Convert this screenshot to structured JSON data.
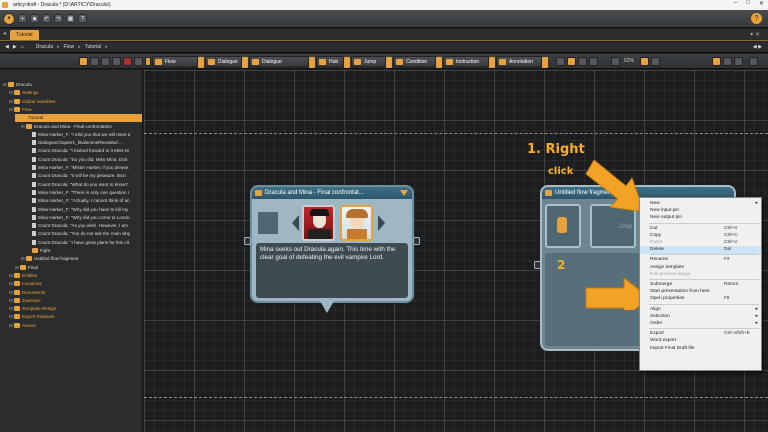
{
  "window": {
    "title": "articy:draft - Dracula * (D:\\ARTICY\\Dracula\\)"
  },
  "tabs": [
    {
      "label": "Tutorial"
    }
  ],
  "breadcrumb": {
    "items": [
      "Dracula",
      "Flow",
      "Tutorial"
    ]
  },
  "object_toolbar": {
    "buttons": [
      "Flow Fragment",
      "Dialogue",
      "Dialogue Fragment",
      "Hub",
      "Jump",
      "Condition",
      "Instruction",
      "Annotation"
    ],
    "zoom_value": "62%"
  },
  "tree": {
    "items": [
      {
        "label": "Dracula",
        "depth": 0,
        "icon": "project-icon"
      },
      {
        "label": "Settings",
        "depth": 1,
        "icon": "folder-icon",
        "orange": true
      },
      {
        "label": "Global Variables",
        "depth": 1,
        "icon": "folder-icon",
        "orange": true
      },
      {
        "label": "Flow",
        "depth": 1,
        "icon": "folder-icon",
        "orange": true
      },
      {
        "label": "Tutorial",
        "depth": 2,
        "icon": "folder-icon",
        "selected": true
      },
      {
        "label": "Dracula and Mina - Final confrontation",
        "depth": 3,
        "icon": "folder-icon"
      },
      {
        "label": "Mina Harker_F: \"I told you that we will meet a",
        "depth": 4,
        "icon": "doc-icon"
      },
      {
        "label": "DialogueChapter1_finalsceneRevealed ...",
        "depth": 4,
        "icon": "doc-icon"
      },
      {
        "label": "Count Dracula: \"I looked forward to it Miss M",
        "depth": 4,
        "icon": "doc-icon"
      },
      {
        "label": "Count Dracula: \"So you did, Miss Mina.  Don",
        "depth": 4,
        "icon": "doc-icon"
      },
      {
        "label": "Mina Harker_F: \"Mister Harker, if you please.",
        "depth": 4,
        "icon": "doc-icon"
      },
      {
        "label": "Count Dracula: \"It will be my pleasure. But I",
        "depth": 4,
        "icon": "doc-icon"
      },
      {
        "label": "Count Dracula: \"What do you want to know?",
        "depth": 4,
        "icon": "doc-icon"
      },
      {
        "label": "Mina Harker_F: \"There is only one question I",
        "depth": 4,
        "icon": "doc-icon"
      },
      {
        "label": "Mina Harker_F: \"Actually, I cannot think of an",
        "depth": 4,
        "icon": "doc-icon"
      },
      {
        "label": "Mina Harker_F: \"Why did you have to kill my",
        "depth": 4,
        "icon": "doc-icon"
      },
      {
        "label": "Mina Harker_F: \"Why did you come to Londo",
        "depth": 4,
        "icon": "doc-icon"
      },
      {
        "label": "Count Dracula: \"As you wish. However, I am",
        "depth": 4,
        "icon": "doc-icon"
      },
      {
        "label": "Count Dracula: \"You do not ask the main why",
        "depth": 4,
        "icon": "doc-icon"
      },
      {
        "label": "Count Dracula: \"I have great plans for this cit",
        "depth": 4,
        "icon": "doc-icon"
      },
      {
        "label": "Fight",
        "depth": 4,
        "icon": "folder-icon"
      },
      {
        "label": "Untitled flow fragment",
        "depth": 3,
        "icon": "folder-icon"
      },
      {
        "label": "Final",
        "depth": 2,
        "icon": "folder-icon"
      },
      {
        "label": "Entities",
        "depth": 1,
        "icon": "folder-icon",
        "orange": true
      },
      {
        "label": "Locations",
        "depth": 1,
        "icon": "folder-icon",
        "orange": true
      },
      {
        "label": "Documents",
        "depth": 1,
        "icon": "folder-icon",
        "orange": true
      },
      {
        "label": "Journeys",
        "depth": 1,
        "icon": "folder-icon",
        "orange": true
      },
      {
        "label": "Template Design",
        "depth": 1,
        "icon": "folder-icon",
        "orange": true
      },
      {
        "label": "Export Rulesets",
        "depth": 1,
        "icon": "folder-icon",
        "orange": true
      },
      {
        "label": "Assets",
        "depth": 1,
        "icon": "folder-icon",
        "orange": true
      }
    ]
  },
  "node_dialogue": {
    "title": "Dracula and Mina - Final confrontat...",
    "text": "Mina seeks out Dracula again. This time with the clear goal of defeating the evil vampire Lord."
  },
  "node_flow": {
    "title": "Untitled flow fragment",
    "drag_hint": "Drag"
  },
  "annotations": {
    "step1": "1. Right",
    "step1b": "click",
    "step2": "2"
  },
  "context_menu": {
    "items": [
      {
        "label": "New",
        "shortcut": "",
        "arrow": true
      },
      {
        "label": "New input pin",
        "shortcut": ""
      },
      {
        "label": "New output pin",
        "shortcut": ""
      },
      {
        "sep": true
      },
      {
        "label": "Cut",
        "shortcut": "Ctrl+X"
      },
      {
        "label": "Copy",
        "shortcut": "Ctrl+C"
      },
      {
        "label": "Paste",
        "shortcut": "Ctrl+V",
        "disabled": true
      },
      {
        "label": "Delete",
        "shortcut": "Del",
        "highlight": true
      },
      {
        "sep": true
      },
      {
        "label": "Rename",
        "shortcut": "F2"
      },
      {
        "label": "Assign template",
        "shortcut": ""
      },
      {
        "label": "Edit preview image",
        "shortcut": "",
        "disabled": true
      },
      {
        "sep": true
      },
      {
        "label": "Submerge",
        "shortcut": "Return"
      },
      {
        "label": "Start presentation from here",
        "shortcut": ""
      },
      {
        "label": "Open properties",
        "shortcut": "F8"
      },
      {
        "sep": true
      },
      {
        "label": "Align",
        "shortcut": "",
        "arrow": true
      },
      {
        "label": "Selection",
        "shortcut": "",
        "arrow": true
      },
      {
        "label": "Order",
        "shortcut": "",
        "arrow": true
      },
      {
        "sep": true
      },
      {
        "label": "Export",
        "shortcut": "Ctrl+Shift+E"
      },
      {
        "label": "Word export",
        "shortcut": ""
      },
      {
        "label": "Import Final Draft file",
        "shortcut": ""
      }
    ]
  },
  "colors": {
    "accent": "#e9a23b",
    "canvas": "#1b1d1f",
    "node_header": "#2d566b"
  }
}
